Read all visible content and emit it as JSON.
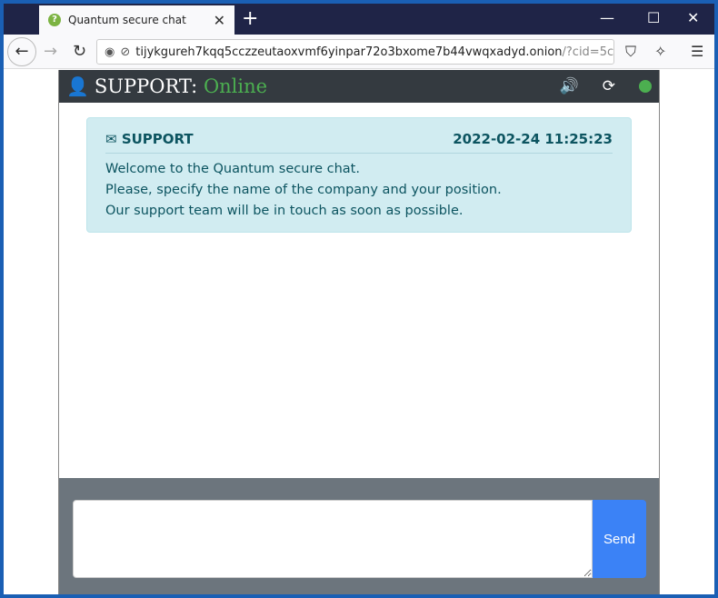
{
  "browser": {
    "tab_title": "Quantum secure chat",
    "url_main": "tijykgureh7kqq5cczzeutaoxvmf6yinpar72o3bxome7b44vwqxadyd.onion",
    "url_query": "/?cid=5c"
  },
  "chat": {
    "header_label": "SUPPORT:",
    "status": "Online",
    "status_color": "#4caf50",
    "message": {
      "sender": "SUPPORT",
      "timestamp": "2022-02-24 11:25:23",
      "lines": [
        "Welcome to the Quantum secure chat.",
        "Please, specify the name of the company and your position.",
        "Our support team will be in touch as soon as possible."
      ]
    },
    "send_label": "Send"
  }
}
